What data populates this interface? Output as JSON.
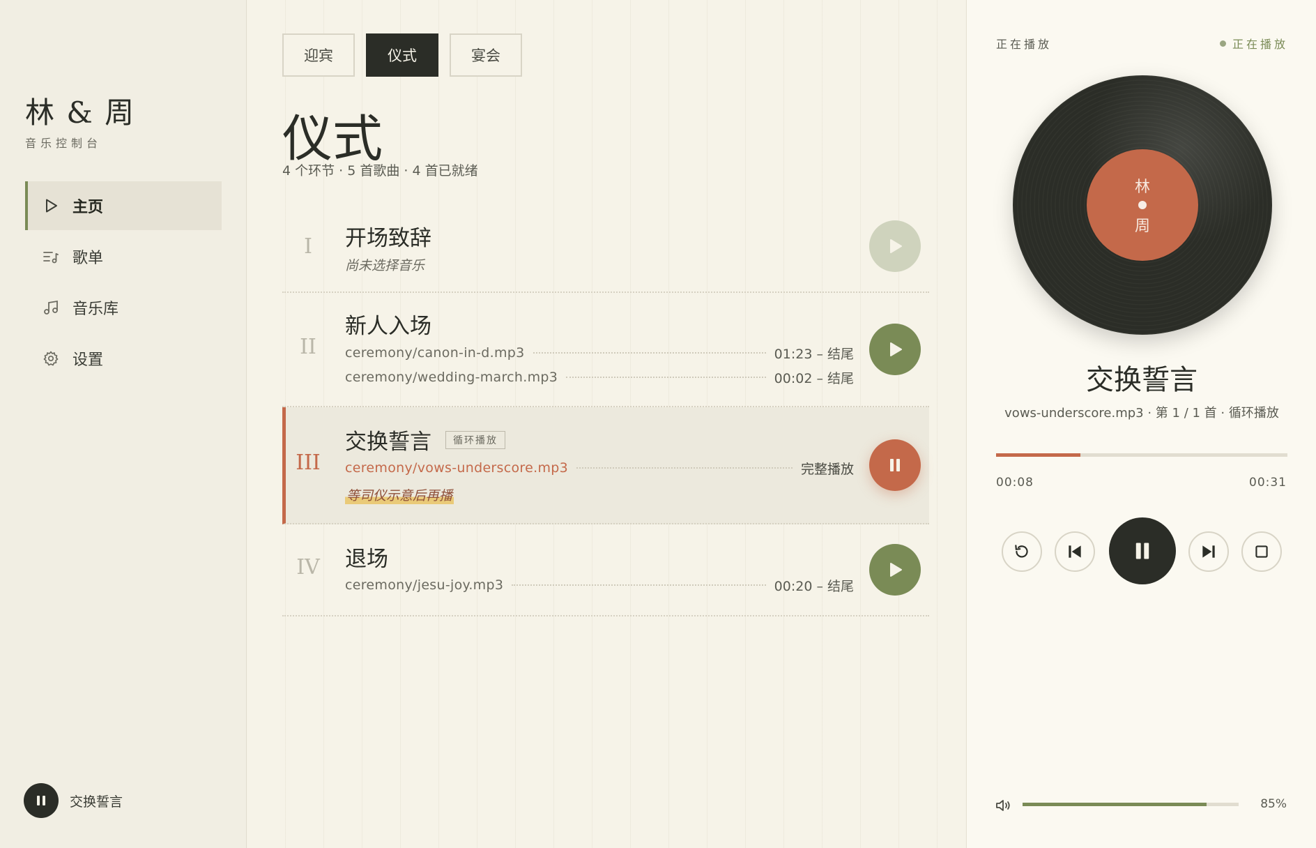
{
  "brand": {
    "title": "林 & 周",
    "subtitle": "音乐控制台"
  },
  "nav": [
    {
      "label": "主页",
      "icon": "play-outline-icon",
      "active": true
    },
    {
      "label": "歌单",
      "icon": "playlist-icon",
      "active": false
    },
    {
      "label": "音乐库",
      "icon": "music-note-icon",
      "active": false
    },
    {
      "label": "设置",
      "icon": "gear-icon",
      "active": false
    }
  ],
  "mini_player": {
    "title": "交换誓言"
  },
  "tabs": [
    {
      "label": "迎宾",
      "active": false
    },
    {
      "label": "仪式",
      "active": true
    },
    {
      "label": "宴会",
      "active": false
    }
  ],
  "page": {
    "title": "仪式",
    "subtitle": "4 个环节 · 5 首歌曲 · 4 首已就绪"
  },
  "sections": [
    {
      "numeral": "I",
      "title": "开场致辞",
      "empty_text": "尚未选择音乐",
      "state": "disabled"
    },
    {
      "numeral": "II",
      "title": "新人入场",
      "state": "ready",
      "tracks": [
        {
          "file": "ceremony/canon-in-d.mp3",
          "meta": "01:23 – 结尾"
        },
        {
          "file": "ceremony/wedding-march.mp3",
          "meta": "00:02 – 结尾"
        }
      ]
    },
    {
      "numeral": "III",
      "title": "交换誓言",
      "badge": "循环播放",
      "state": "playing",
      "tracks": [
        {
          "file": "ceremony/vows-underscore.mp3",
          "meta": "完整播放"
        }
      ],
      "note": "等司仪示意后再播"
    },
    {
      "numeral": "IV",
      "title": "退场",
      "state": "ready",
      "tracks": [
        {
          "file": "ceremony/jesu-joy.mp3",
          "meta": "00:20 – 结尾"
        }
      ]
    }
  ],
  "player": {
    "label": "正在播放",
    "status": "正在播放",
    "vinyl_top": "林",
    "vinyl_bottom": "周",
    "title": "交换誓言",
    "subtitle": "vows-underscore.mp3 · 第 1 / 1 首 · 循环播放",
    "current_time": "00:08",
    "total_time": "00:31",
    "progress": 0.29,
    "volume_text": "85%",
    "volume": 0.85
  },
  "colors": {
    "accent": "#c4694a",
    "green": "#7a8b56",
    "dark": "#2b2d27",
    "background": "#f4f1e6"
  }
}
